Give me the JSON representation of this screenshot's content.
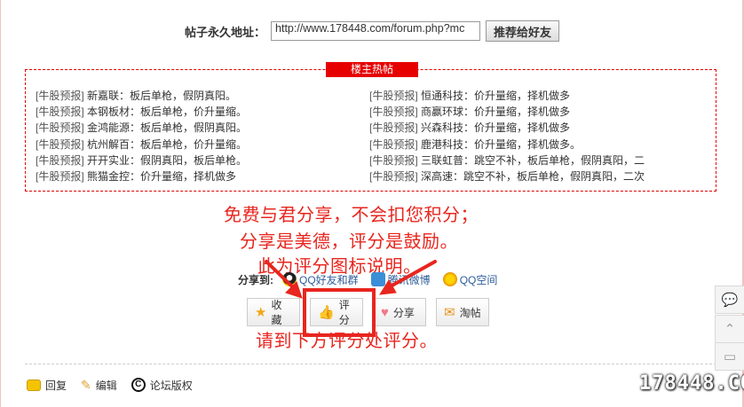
{
  "permalink": {
    "label": "帖子永久地址：",
    "value": "http://www.178448.com/forum.php?mc",
    "button_label": "推荐给好友"
  },
  "hot_posts": {
    "title": "楼主热帖",
    "left": [
      {
        "tag": "[牛股预报]",
        "text": "新嘉联：板后单枪，假阴真阳。"
      },
      {
        "tag": "[牛股预报]",
        "text": "本钢板材：板后单枪，价升量缩。"
      },
      {
        "tag": "[牛股预报]",
        "text": "金鸿能源：板后单枪，假阴真阳。"
      },
      {
        "tag": "[牛股预报]",
        "text": "杭州解百：板后单枪，价升量缩。"
      },
      {
        "tag": "[牛股预报]",
        "text": "开开实业：假阴真阳，板后单枪。"
      },
      {
        "tag": "[牛股预报]",
        "text": "熊猫金控：价升量缩，择机做多"
      }
    ],
    "right": [
      {
        "tag": "[牛股预报]",
        "text": "恒通科技：价升量缩，择机做多"
      },
      {
        "tag": "[牛股预报]",
        "text": "商赢环球：价升量缩，择机做多"
      },
      {
        "tag": "[牛股预报]",
        "text": "兴森科技：价升量缩，择机做多"
      },
      {
        "tag": "[牛股预报]",
        "text": "鹿港科技：价升量缩，择机做多。"
      },
      {
        "tag": "[牛股预报]",
        "text": "三联虹普：跳空不补，板后单枪，假阴真阳，二"
      },
      {
        "tag": "[牛股预报]",
        "text": "深高速：跳空不补，板后单枪，假阴真阳，二次"
      }
    ]
  },
  "annotations": {
    "line1": "免费与君分享，不会扣您积分；",
    "line2": "分享是美德，评分是鼓励。",
    "line3": "此为评分图标说明。",
    "line4": "请到下方评分处评分。"
  },
  "share": {
    "label": "分享到:",
    "qq_friends": "QQ好友和群",
    "tencent_weibo": "腾讯微博",
    "qzone": "QQ空间"
  },
  "actions": {
    "collect": "收藏",
    "rate": "评分",
    "share": "分享",
    "taotie": "淘帖"
  },
  "toolbar": {
    "reply": "回复",
    "edit": "编辑",
    "copyright": "论坛版权"
  },
  "watermark": "178448.COM",
  "icons": {
    "qq": "qq-penguin-icon",
    "weibo": "tencent-weibo-icon",
    "qzone": "qzone-star-icon",
    "collect": "star-icon",
    "rate": "thumbs-up-icon",
    "share": "heart-icon",
    "taotie": "envelope-icon"
  },
  "colors": {
    "accent_red": "#e8251e",
    "hot_title_bg": "#e60000",
    "link_blue": "#2e5d99"
  }
}
